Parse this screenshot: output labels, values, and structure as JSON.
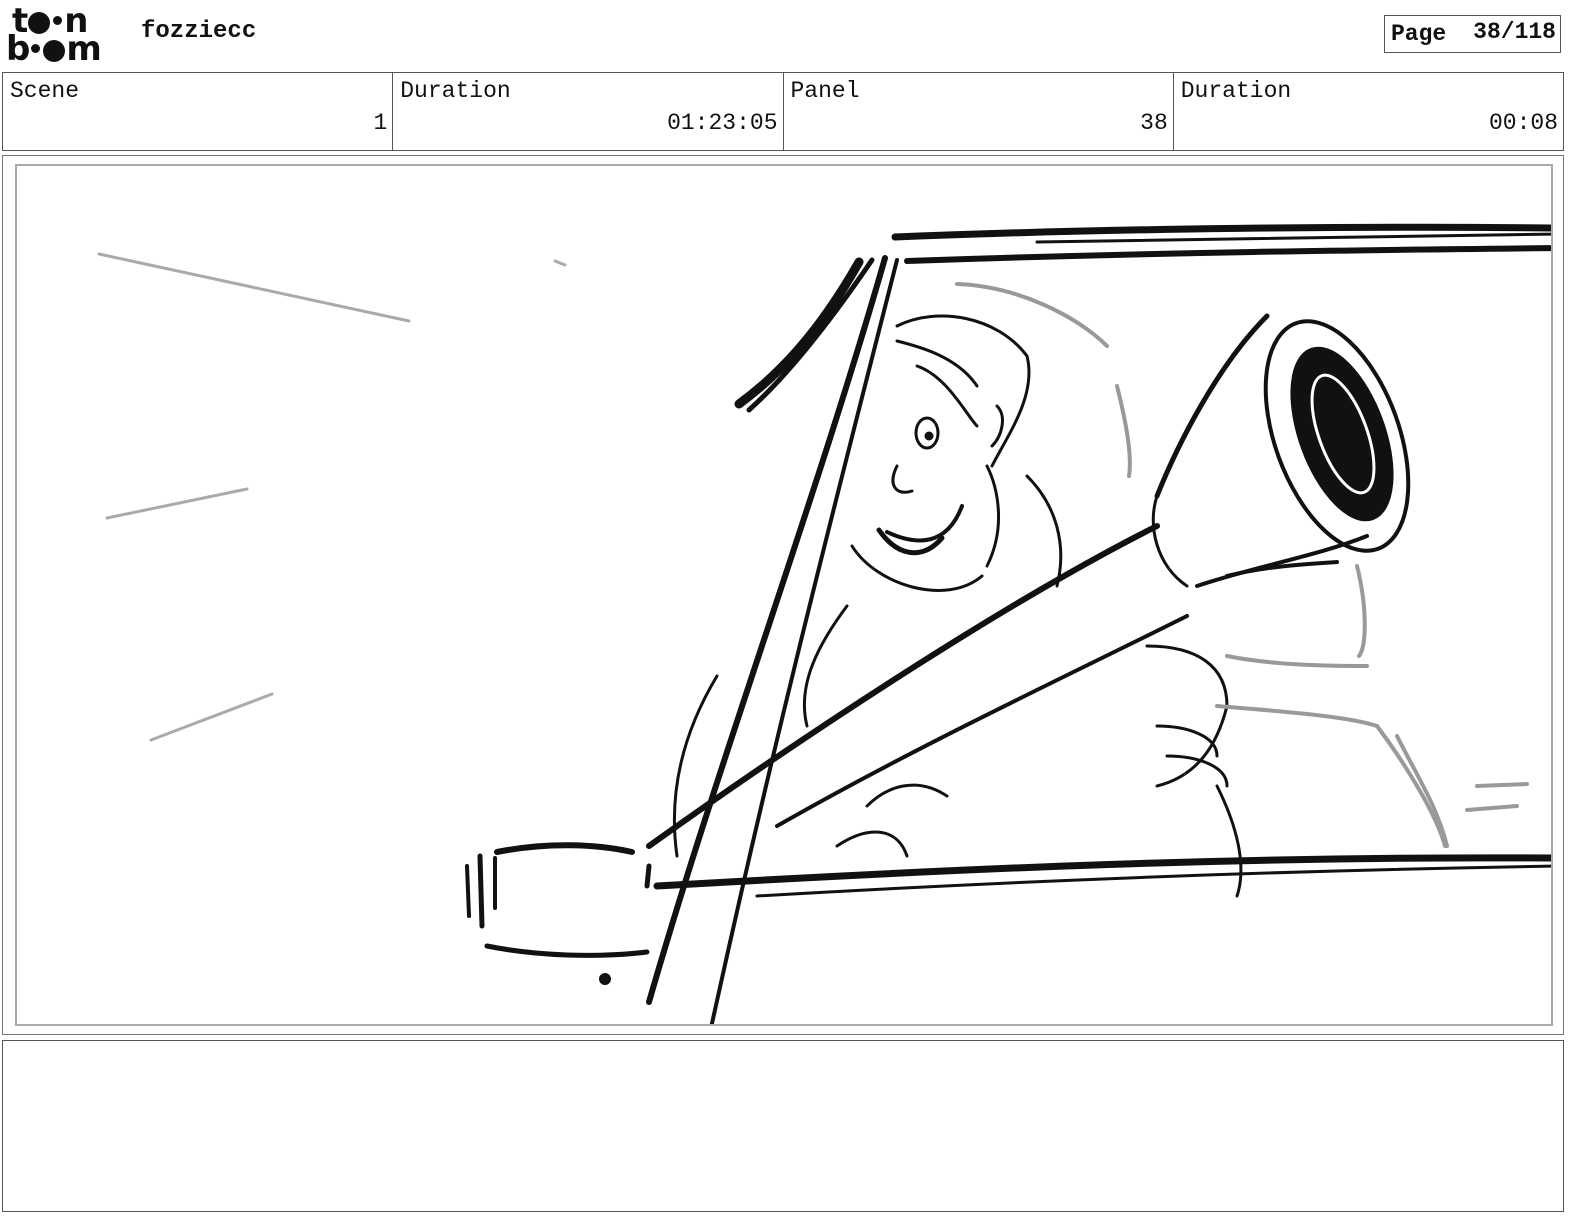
{
  "header": {
    "logo_text": "toon boom",
    "project_name": "fozziecc",
    "page_label": "Page",
    "page_value": "38/118"
  },
  "info": {
    "scene_label": "Scene",
    "scene_value": "1",
    "scene_duration_label": "Duration",
    "scene_duration_value": "01:23:05",
    "panel_label": "Panel",
    "panel_value": "38",
    "panel_duration_label": "Duration",
    "panel_duration_value": "00:08"
  },
  "panel": {
    "image_subject": "Storyboard sketch: character in a car window holding a megaphone"
  },
  "notes": {
    "text": ""
  }
}
